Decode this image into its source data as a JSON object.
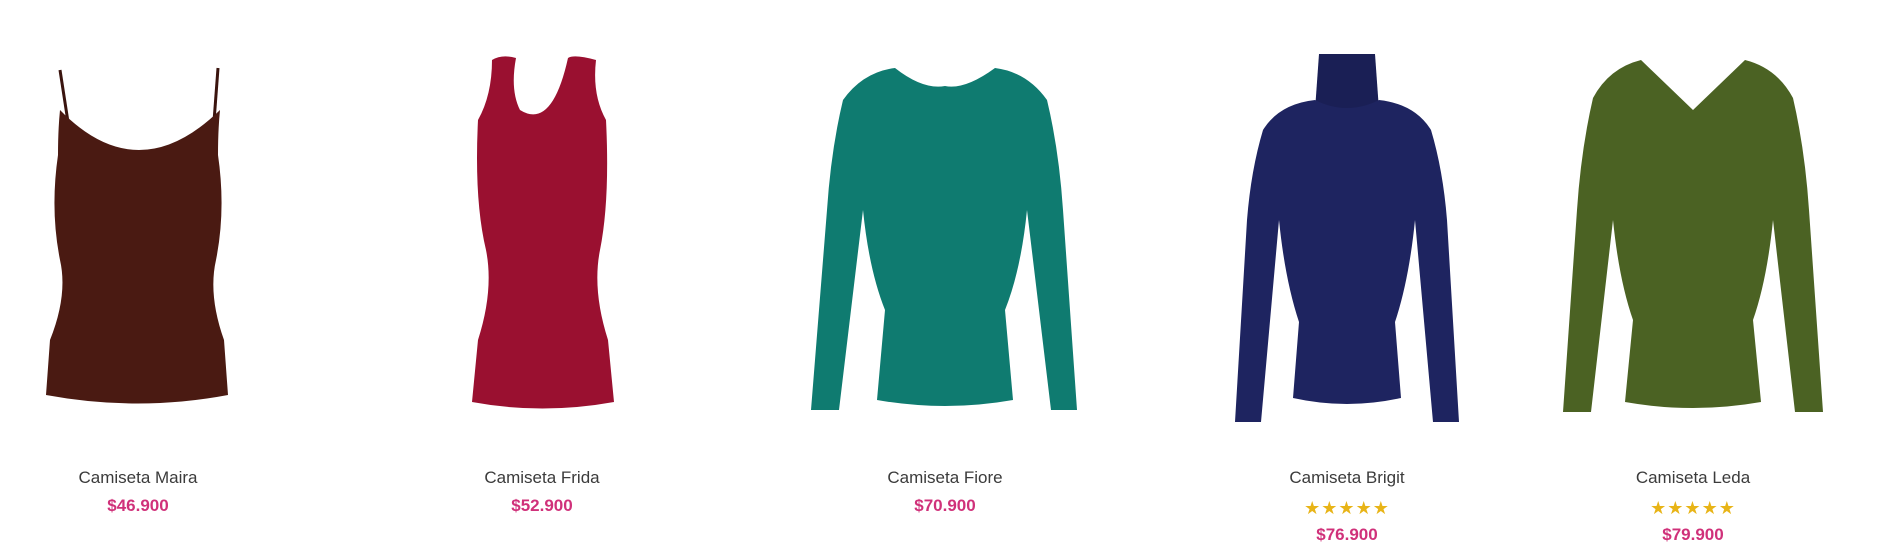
{
  "products": [
    {
      "name": "Camiseta Maira",
      "price": "$46.900",
      "rating": null,
      "color": "#4a1a12"
    },
    {
      "name": "Camiseta Frida",
      "price": "$52.900",
      "rating": null,
      "color": "#9a1030"
    },
    {
      "name": "Camiseta Fiore",
      "price": "$70.900",
      "rating": null,
      "color": "#0f7b70"
    },
    {
      "name": "Camiseta Brigit",
      "price": "$76.900",
      "rating": 5,
      "stars": "★★★★★",
      "color": "#1e2460"
    },
    {
      "name": "Camiseta Leda",
      "price": "$79.900",
      "rating": 5,
      "stars": "★★★★★",
      "color": "#4b6223"
    }
  ],
  "colors": {
    "price": "#d0317a",
    "star": "#e8b417",
    "name": "#3b3b3b"
  }
}
